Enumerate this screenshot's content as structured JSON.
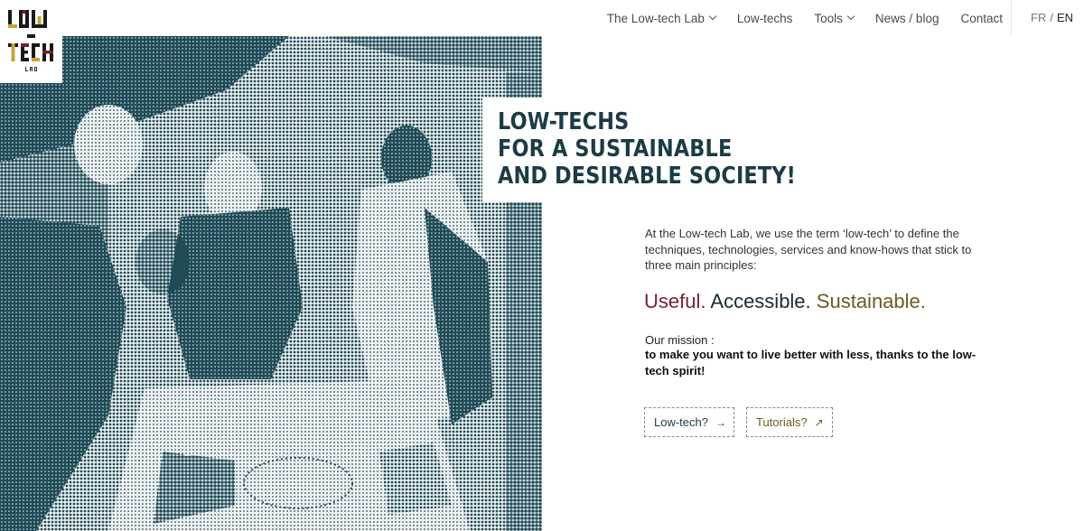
{
  "logo": {
    "text_top": "LOW",
    "text_mid": "-",
    "text_bottom": "TECH",
    "text_small": "LAB"
  },
  "nav": {
    "items": [
      {
        "label": "The Low-tech Lab",
        "dropdown": true
      },
      {
        "label": "Low-techs",
        "dropdown": false
      },
      {
        "label": "Tools",
        "dropdown": true
      },
      {
        "label": "News / blog",
        "dropdown": false
      },
      {
        "label": "Contact",
        "dropdown": false
      }
    ],
    "lang_fr": "FR",
    "lang_separator": "/",
    "lang_en": "EN"
  },
  "hero": {
    "headline": [
      "LOW-TECHS",
      "FOR A SUSTAINABLE",
      "AND DESIRABLE SOCIETY!"
    ]
  },
  "content": {
    "intro": "At the Low-tech Lab, we use the term ‘low-tech’ to define the techniques, technologies, services and know-hows that stick to three main principles:",
    "principles": {
      "useful": "Useful.",
      "accessible": "Accessible.",
      "sustainable": "Sustainable."
    },
    "mission_label": "Our mission :",
    "mission_text": "to make you want to live better with less, thanks to the low-tech spirit!"
  },
  "buttons": {
    "lowtech": {
      "label": "Low-tech?",
      "icon": "arrow-right-icon",
      "arrow": "→"
    },
    "tutorials": {
      "label": "Tutorials?",
      "icon": "arrow-up-right-icon",
      "arrow": "↗"
    }
  },
  "colors": {
    "headline": "#1b3b46",
    "useful": "#7a1f34",
    "accessible": "#1b2a33",
    "sustainable": "#6d5a1e",
    "hero_tint": "#1f4b57"
  }
}
